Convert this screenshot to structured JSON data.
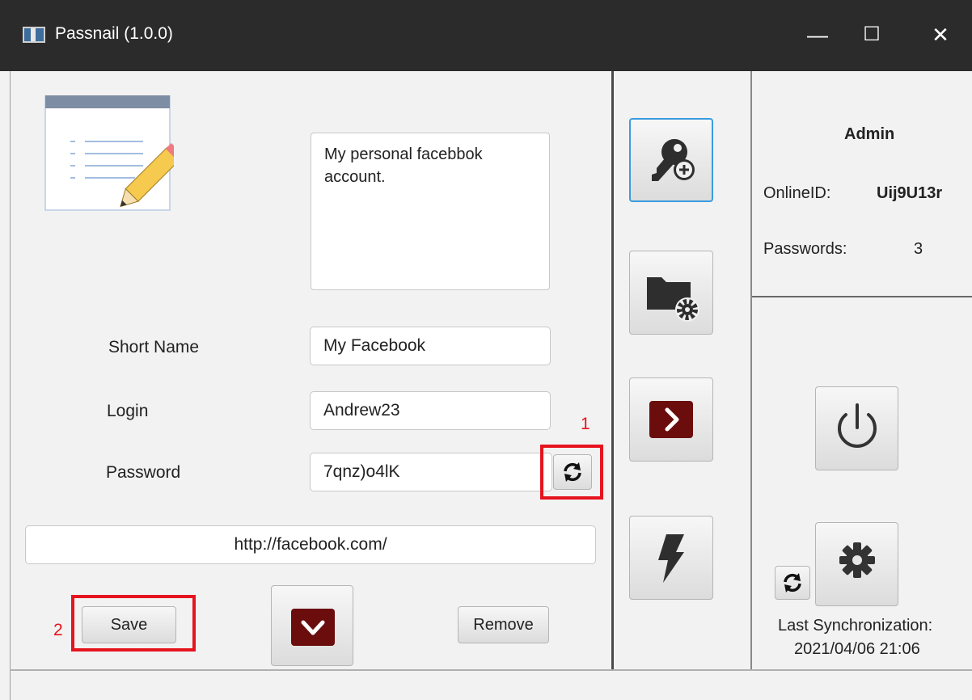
{
  "window": {
    "title": "Passnail (1.0.0)",
    "minimize_glyph": "—",
    "maximize_glyph": "☐",
    "close_glyph": "✕"
  },
  "entry": {
    "description": "My personal facebbok account.",
    "short_name_label": "Short Name",
    "short_name_value": "My Facebook",
    "login_label": "Login",
    "login_value": "Andrew23",
    "password_label": "Password",
    "password_value": "7qnz)o4lK",
    "url_value": "http://facebook.com/",
    "save_label": "Save",
    "remove_label": "Remove"
  },
  "annotations": {
    "first": "1",
    "second": "2"
  },
  "user": {
    "name": "Admin",
    "online_id_label": "OnlineID:",
    "online_id_value": "Uij9U13r",
    "passwords_label": "Passwords:",
    "passwords_count": "3"
  },
  "sync": {
    "last_label": "Last Synchronization:",
    "last_value": "2021/04/06 21:06"
  },
  "icons": {
    "entry_edit": "notepad-pencil-icon",
    "regenerate": "refresh-icon",
    "expand": "chevron-down-icon",
    "add_key": "key-add-icon",
    "folder_settings": "folder-gear-icon",
    "forward": "chevron-right-icon",
    "quick": "lightning-icon",
    "power": "power-icon",
    "settings": "gear-icon",
    "sync": "refresh-icon"
  },
  "colors": {
    "titlebar": "#2b2b2b",
    "accent_dark_red": "#6b0d0d",
    "annotation_red": "#e6141e",
    "focus_blue": "#3b9be0"
  }
}
